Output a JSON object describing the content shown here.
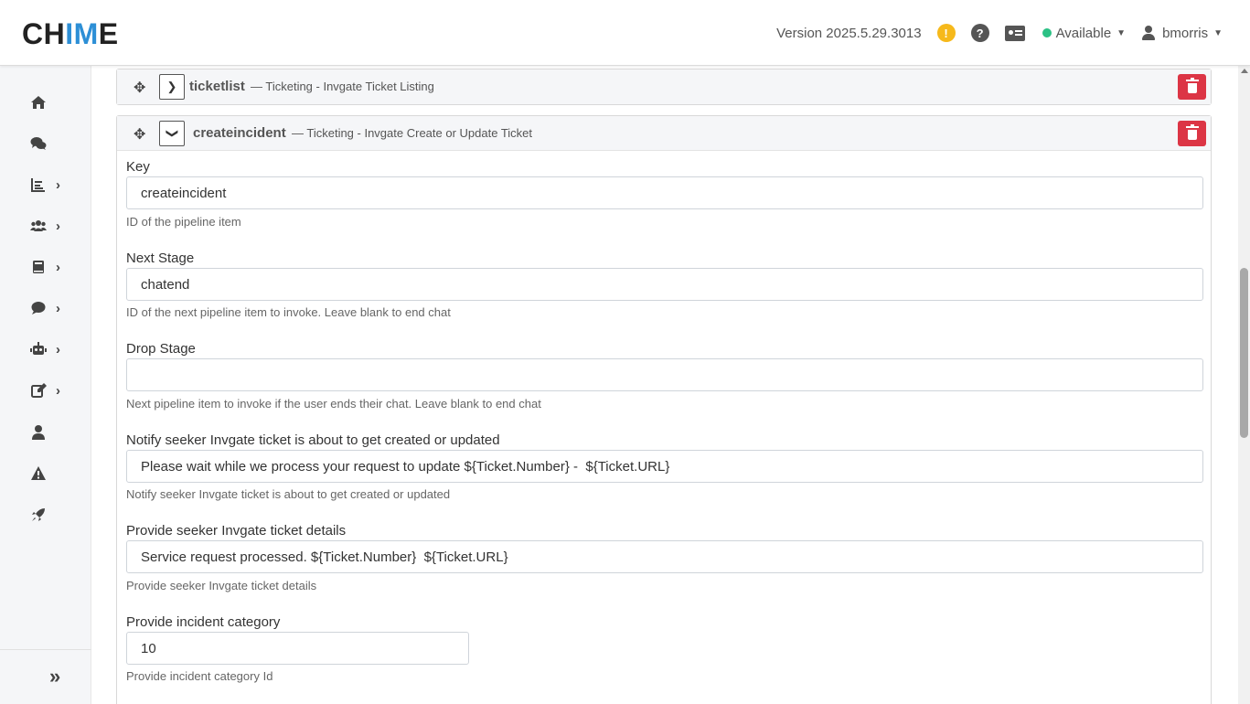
{
  "header": {
    "logo_part1": "CH",
    "logo_part2": "IM",
    "logo_part3": "E",
    "version": "Version 2025.5.29.3013",
    "warning_glyph": "!",
    "help_glyph": "?",
    "status": "Available",
    "username": "bmorris"
  },
  "sidebar": {
    "items": [
      {
        "icon": "home-icon",
        "has_chevron": false
      },
      {
        "icon": "chat-bubbles-icon",
        "has_chevron": false
      },
      {
        "icon": "chart-icon",
        "has_chevron": true
      },
      {
        "icon": "users-icon",
        "has_chevron": true
      },
      {
        "icon": "book-icon",
        "has_chevron": true
      },
      {
        "icon": "comment-icon",
        "has_chevron": true
      },
      {
        "icon": "robot-icon",
        "has_chevron": true
      },
      {
        "icon": "edit-icon",
        "has_chevron": true
      },
      {
        "icon": "user-icon",
        "has_chevron": false
      },
      {
        "icon": "warning-icon",
        "has_chevron": false
      },
      {
        "icon": "rocket-icon",
        "has_chevron": false
      }
    ],
    "expand_glyph": "»"
  },
  "panels": [
    {
      "key": "ticketlist",
      "description": "— Ticketing - Invgate Ticket Listing",
      "expanded": false
    },
    {
      "key": "createincident",
      "description": "— Ticketing - Invgate Create or Update Ticket",
      "expanded": true
    }
  ],
  "form": {
    "key": {
      "label": "Key",
      "value": "createincident",
      "help": "ID of the pipeline item"
    },
    "next_stage": {
      "label": "Next Stage",
      "value": "chatend",
      "help": "ID of the next pipeline item to invoke. Leave blank to end chat"
    },
    "drop_stage": {
      "label": "Drop Stage",
      "value": "",
      "help": "Next pipeline item to invoke if the user ends their chat. Leave blank to end chat"
    },
    "notify": {
      "label": "Notify seeker Invgate ticket is about to get created or updated",
      "value": "Please wait while we process your request to update ${Ticket.Number} -  ${Ticket.URL}",
      "help": "Notify seeker Invgate ticket is about to get created or updated"
    },
    "details": {
      "label": "Provide seeker Invgate ticket details",
      "value": "Service request processed. ${Ticket.Number}  ${Ticket.URL}",
      "help": "Provide seeker Invgate ticket details"
    },
    "category": {
      "label": "Provide incident category",
      "value": "10",
      "help": "Provide incident category Id"
    }
  },
  "colors": {
    "accent": "#2d8fd6",
    "danger": "#dc3545",
    "status_green": "#2cc185",
    "warning": "#f6b91b"
  }
}
